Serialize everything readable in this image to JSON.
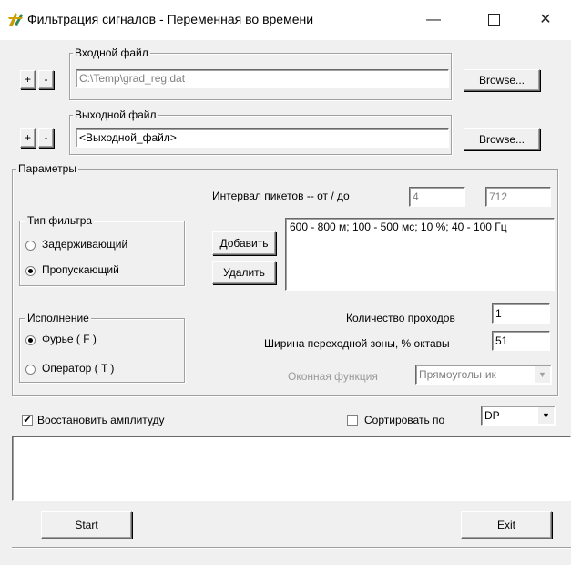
{
  "window": {
    "title": "Фильтрация сигналов - Переменная во времени",
    "minimize_glyph": "—",
    "maximize_glyph": "",
    "close_glyph": "✕"
  },
  "input_file": {
    "label": "Входной файл",
    "value": "C:\\Temp\\grad_reg.dat",
    "plus": "+",
    "minus": "-",
    "browse": "Browse..."
  },
  "output_file": {
    "label": "Выходной файл",
    "value": "<Выходной_файл>",
    "plus": "+",
    "minus": "-",
    "browse": "Browse..."
  },
  "params": {
    "label": "Параметры",
    "interval_label": "Интервал пикетов  -- от  /  до",
    "interval_from": "4",
    "interval_to": "712",
    "filter_type": {
      "label": "Тип фильтра",
      "options": [
        "Задерживающий",
        "Пропускающий"
      ],
      "selected": 1
    },
    "add_button": "Добавить",
    "delete_button": "Удалить",
    "list_items": [
      "600 - 800 м; 100 - 500 мс; 10 %; 40 - 100 Гц"
    ],
    "execution": {
      "label": "Исполнение",
      "options": [
        "Фурье ( F )",
        "Оператор ( T )"
      ],
      "selected": 0
    },
    "passes_label": "Количество проходов",
    "passes_value": "1",
    "transition_label": "Ширина переходной зоны, % октавы",
    "transition_value": "51",
    "window_func_label": "Оконная функция",
    "window_func_value": "Прямоугольник"
  },
  "restore_amplitude": {
    "label": "Восстановить амплитуду",
    "checked": true
  },
  "sort_by": {
    "label": "Сортировать по",
    "checked": false,
    "value": "DP"
  },
  "log_text": "",
  "start_button": "Start",
  "exit_button": "Exit"
}
